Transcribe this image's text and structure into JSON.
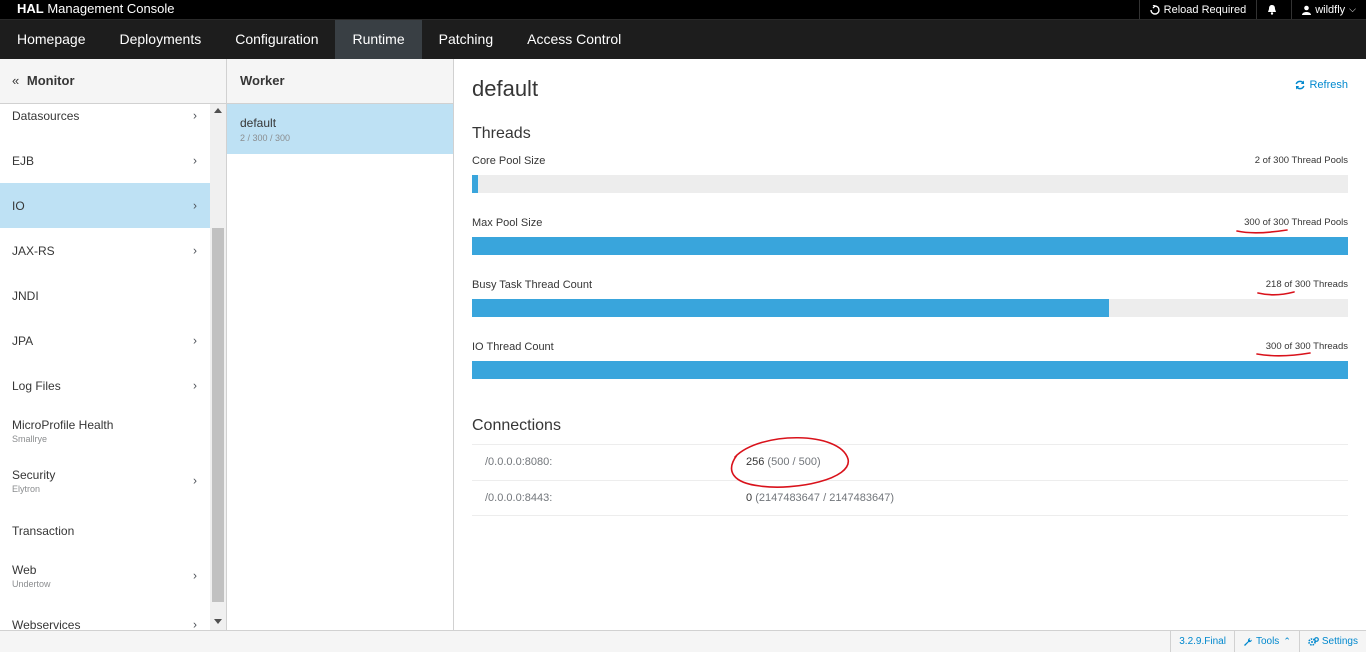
{
  "header": {
    "brand_bold": "HAL",
    "brand_rest": "Management Console",
    "reload": "Reload Required",
    "user": "wildfly"
  },
  "nav": {
    "tabs": [
      "Homepage",
      "Deployments",
      "Configuration",
      "Runtime",
      "Patching",
      "Access Control"
    ],
    "active": "Runtime"
  },
  "monitor": {
    "back": "«",
    "title": "Monitor",
    "items": [
      {
        "label": "Datasources",
        "sub": "",
        "chevron": "›"
      },
      {
        "label": "EJB",
        "sub": "",
        "chevron": "›"
      },
      {
        "label": "IO",
        "sub": "",
        "chevron": "›"
      },
      {
        "label": "JAX-RS",
        "sub": "",
        "chevron": "›"
      },
      {
        "label": "JNDI",
        "sub": "",
        "chevron": ""
      },
      {
        "label": "JPA",
        "sub": "",
        "chevron": "›"
      },
      {
        "label": "Log Files",
        "sub": "",
        "chevron": "›"
      },
      {
        "label": "MicroProfile Health",
        "sub": "Smallrye",
        "chevron": ""
      },
      {
        "label": "Security",
        "sub": "Elytron",
        "chevron": "›"
      },
      {
        "label": "Transaction",
        "sub": "",
        "chevron": ""
      },
      {
        "label": "Web",
        "sub": "Undertow",
        "chevron": "›"
      },
      {
        "label": "Webservices",
        "sub": "",
        "chevron": "›"
      }
    ],
    "active": "IO"
  },
  "worker": {
    "title": "Worker",
    "item_name": "default",
    "item_sub": "2 / 300 / 300"
  },
  "main": {
    "title": "default",
    "refresh": "Refresh",
    "threads_title": "Threads",
    "threads": [
      {
        "label": "Core Pool Size",
        "value": "2 of 300 Thread Pools",
        "fraction": 0.0067
      },
      {
        "label": "Max Pool Size",
        "value": "300 of 300 Thread Pools",
        "fraction": 1.0
      },
      {
        "label": "Busy Task Thread Count",
        "value": "218 of 300 Threads",
        "fraction": 0.7267
      },
      {
        "label": "IO Thread Count",
        "value": "300 of 300 Threads",
        "fraction": 1.0
      }
    ],
    "connections_title": "Connections",
    "connections": [
      {
        "address": "/0.0.0.0:8080:",
        "value": "256",
        "detail": "(500 / 500)"
      },
      {
        "address": "/0.0.0.0:8443:",
        "value": "0",
        "detail": "(2147483647 / 2147483647)"
      }
    ]
  },
  "footer": {
    "version": "3.2.9.Final",
    "tools": "Tools",
    "settings": "Settings"
  },
  "colors": {
    "accent": "#39a5dc",
    "link": "#0088ce",
    "selection": "#bee1f4",
    "annotation": "#d9121b"
  }
}
